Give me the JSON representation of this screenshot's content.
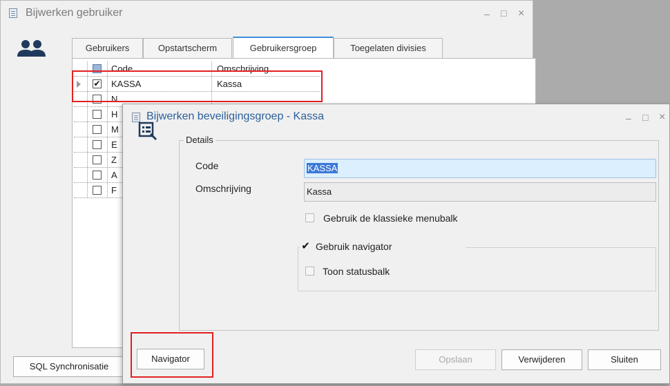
{
  "back_window": {
    "title": "Bijwerken gebruiker",
    "controls": {
      "minimize": "–",
      "maximize": "□",
      "close": "×"
    },
    "tabs": [
      {
        "label": "Gebruikers",
        "active": false
      },
      {
        "label": "Opstartscherm",
        "active": false
      },
      {
        "label": "Gebruikersgroep",
        "active": true
      },
      {
        "label": "Toegelaten divisies",
        "active": false
      }
    ],
    "grid": {
      "headers": {
        "code": "Code",
        "description": "Omschrijving"
      },
      "rows": [
        {
          "code": "KASSA",
          "description": "Kassa",
          "checked": true
        },
        {
          "code": "N",
          "description": "",
          "checked": false
        },
        {
          "code": "H",
          "description": "",
          "checked": false
        },
        {
          "code": "M",
          "description": "",
          "checked": false
        },
        {
          "code": "E",
          "description": "",
          "checked": false
        },
        {
          "code": "Z",
          "description": "",
          "checked": false
        },
        {
          "code": "A",
          "description": "",
          "checked": false
        },
        {
          "code": "F",
          "description": "",
          "checked": false
        }
      ]
    },
    "sql_button": "SQL Synchronisatie"
  },
  "dialog": {
    "title": "Bijwerken beveiligingsgroep - Kassa",
    "controls": {
      "minimize": "–",
      "maximize": "□",
      "close": "×"
    },
    "details_legend": "Details",
    "code_label": "Code",
    "code_value": "KASSA",
    "description_label": "Omschrijving",
    "description_value": "Kassa",
    "classic_menubar_label": "Gebruik de klassieke menubalk",
    "classic_menubar_checked": false,
    "navigator_label": "Gebruik navigator",
    "navigator_checked": true,
    "statusbar_label": "Toon statusbalk",
    "statusbar_checked": false,
    "buttons": {
      "navigator": "Navigator",
      "save": "Opslaan",
      "delete": "Verwijderen",
      "close": "Sluiten"
    },
    "checkmark": "✔"
  },
  "colors": {
    "accent": "#3c8edb",
    "highlight": "#e02020",
    "title_blue": "#2b5e9b"
  }
}
